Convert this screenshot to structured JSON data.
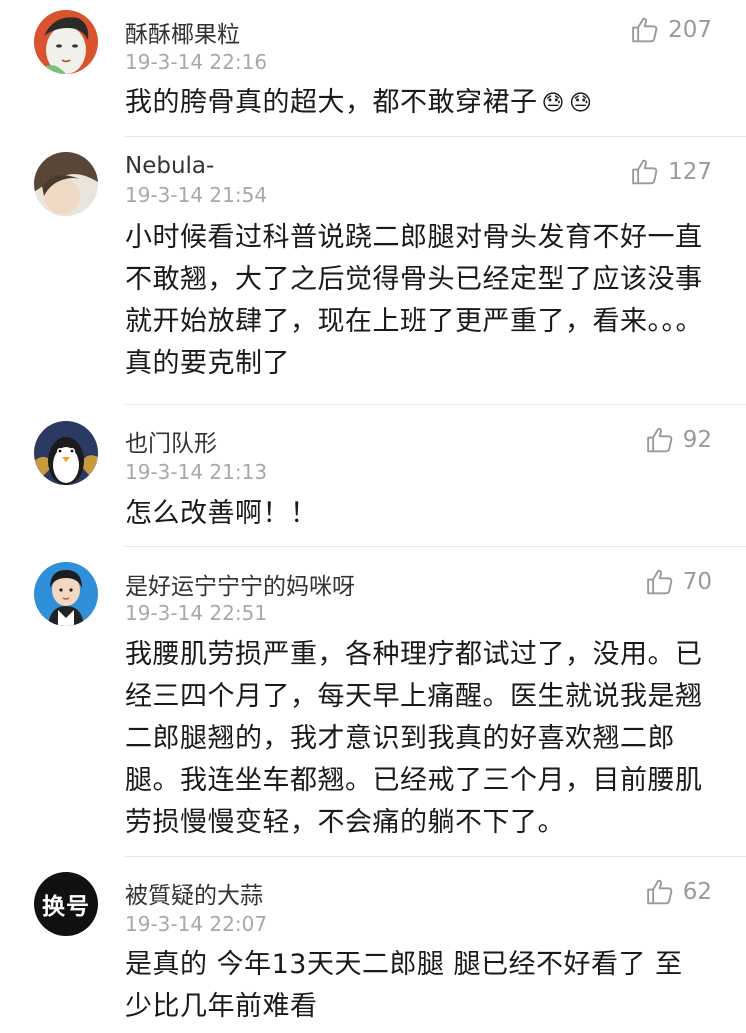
{
  "comments": [
    {
      "username": "酥酥椰果粒",
      "time": "19-3-14 22:16",
      "likes": "207",
      "text": "我的胯骨真的超大，都不敢穿裙子",
      "emojis": [
        "😓",
        "😓"
      ],
      "avatar_icon": "cartoon-face-avatar"
    },
    {
      "username": "Nebula-",
      "time": "19-3-14 21:54",
      "likes": "127",
      "text": "小时候看过科普说跷二郎腿对骨头发育不好一直不敢翘，大了之后觉得骨头已经定型了应该没事就开始放肆了，现在上班了更严重了，看来。。。真的要克制了",
      "avatar_icon": "photo-avatar"
    },
    {
      "username": "也门队形",
      "time": "19-3-14 21:13",
      "likes": "92",
      "text": "怎么改善啊！！",
      "avatar_icon": "penguin-avatar"
    },
    {
      "username": "是好运宁宁宁的妈咪呀",
      "time": "19-3-14 22:51",
      "likes": "70",
      "text": "我腰肌劳损严重，各种理疗都试过了，没用。已经三四个月了，每天早上痛醒。医生就说我是翘二郎腿翘的，我才意识到我真的好喜欢翘二郎腿。我连坐车都翘。已经戒了三个月，目前腰肌劳损慢慢变轻，不会痛的躺不下了。",
      "avatar_icon": "child-photo-avatar"
    },
    {
      "username": "被質疑的大蒜",
      "time": "19-3-14 22:07",
      "likes": "62",
      "text": "是真的 今年13天天二郎腿 腿已经不好看了 至少比几年前难看",
      "avatar_text": "换号",
      "avatar_icon": "text-avatar"
    }
  ],
  "like_icon": "thumbs-up-icon",
  "colors": {
    "text": "#1a1a1a",
    "meta": "#a8a8a8",
    "like": "#9a9a9a",
    "divider": "#e6e6e6"
  }
}
